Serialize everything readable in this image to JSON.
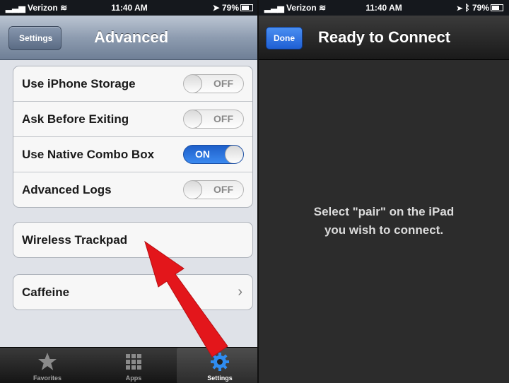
{
  "left_screen": {
    "statusbar": {
      "carrier": "Verizon",
      "time": "11:40 AM",
      "battery": "79%"
    },
    "navbar": {
      "back_label": "Settings",
      "title": "Advanced"
    },
    "toggles": [
      {
        "label": "Use iPhone Storage",
        "state": "OFF"
      },
      {
        "label": "Ask Before Exiting",
        "state": "OFF"
      },
      {
        "label": "Use Native Combo Box",
        "state": "ON"
      },
      {
        "label": "Advanced Logs",
        "state": "OFF"
      }
    ],
    "wireless_trackpad_label": "Wireless Trackpad",
    "caffeine_label": "Caffeine",
    "tabbar": {
      "favorites": "Favorites",
      "apps": "Apps",
      "settings": "Settings"
    }
  },
  "right_screen": {
    "statusbar": {
      "carrier": "Verizon",
      "time": "11:40 AM",
      "battery": "79%"
    },
    "navbar": {
      "done_label": "Done",
      "title": "Ready to Connect"
    },
    "message_line1": "Select \"pair\" on the iPad",
    "message_line2": "you wish to connect."
  },
  "colors": {
    "toggle_on": "#2f78e4",
    "annotation_arrow": "#e3161b"
  }
}
